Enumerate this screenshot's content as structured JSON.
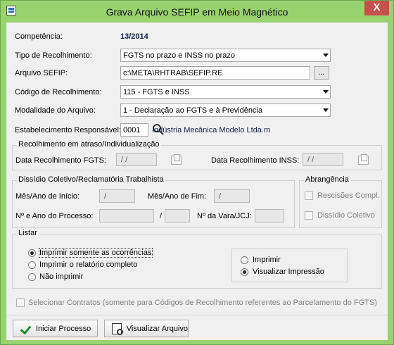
{
  "window": {
    "title": "Grava Arquivo SEFIP em Meio Magnético",
    "close_label": "X"
  },
  "form": {
    "competencia_label": "Competência:",
    "competencia_value": "13/2014",
    "tipo_label": "Tipo de Recolhimento:",
    "tipo_value": "FGTS no prazo e INSS no prazo",
    "arquivo_label": "Arquivo SEFIP:",
    "arquivo_value": "c:\\META\\RHTRAB\\SEFIP.RE",
    "browse_label": "...",
    "codigo_label": "Código de Recolhimento:",
    "codigo_value": "115 - FGTS e INSS",
    "modalidade_label": "Modalidade do Arquivo:",
    "modalidade_value": "1 - Declaração ao FGTS e à Previdência",
    "estabelecimento_label": "Estabelecimento Responsável:",
    "estabelecimento_code": "0001",
    "estabelecimento_name": "Indústria Mecânica Modelo Ltda.m"
  },
  "atraso": {
    "title": "Recolhimento em atraso/Individualização",
    "fgts_label": "Data Recolhimento FGTS:",
    "fgts_value": "/ /",
    "inss_label": "Data Recolhimento INSS:",
    "inss_value": "/ /"
  },
  "dissidio": {
    "title": "Dissídio Coletivo/Reclamatória Trabalhista",
    "inicio_label": "Mês/Ano de Início:",
    "inicio_value": "/",
    "fim_label": "Mês/Ano de Fim:",
    "fim_value": "/",
    "processo_label": "Nº e Ano do Processo:",
    "separator": "/",
    "vara_label": "Nº da Vara/JCJ:"
  },
  "abrangencia": {
    "title": "Abrangência",
    "rescisoes_label": "Rescisões Compl.",
    "dissidio_label": "Dissídio Coletivo"
  },
  "listar": {
    "title": "Listar",
    "options": [
      "Imprimir somente as ocorrências",
      "Imprimir o relatório completo",
      "Não imprimir"
    ],
    "print_options": [
      "Imprimir",
      "Visualizar Impressão"
    ]
  },
  "contracts": {
    "label": "Selecionar Contratos (somente para Códigos de Recolhimento referentes ao Parcelamento do FGTS)"
  },
  "buttons": {
    "start": "Iniciar Processo",
    "view": "Visualizar Arquivo"
  }
}
